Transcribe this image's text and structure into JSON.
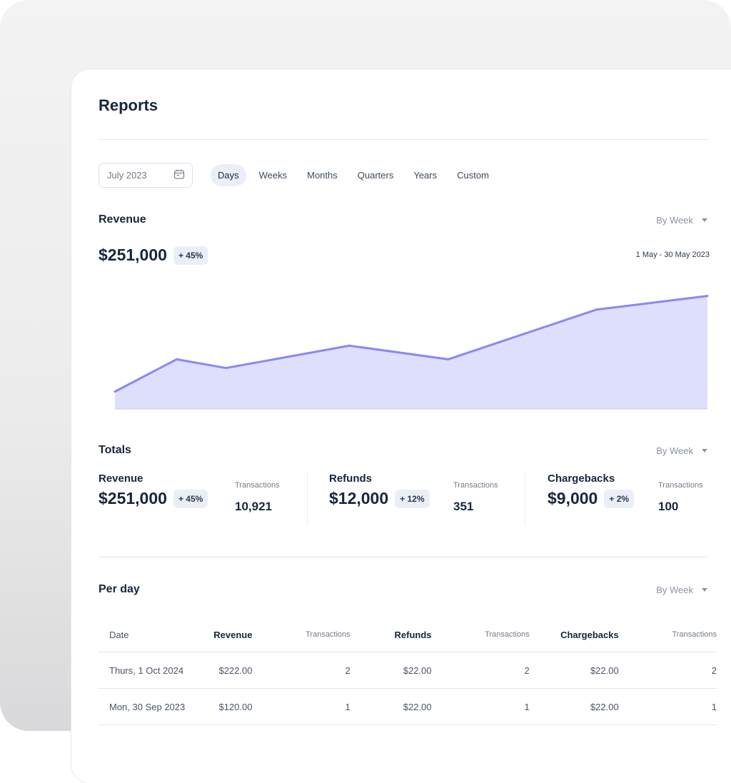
{
  "page": {
    "title": "Reports"
  },
  "filters": {
    "date_value": "July 2023",
    "date_icon": "calendar-icon",
    "tabs": [
      {
        "label": "Days",
        "active": true
      },
      {
        "label": "Weeks",
        "active": false
      },
      {
        "label": "Months",
        "active": false
      },
      {
        "label": "Quarters",
        "active": false
      },
      {
        "label": "Years",
        "active": false
      },
      {
        "label": "Custom",
        "active": false
      }
    ]
  },
  "revenue": {
    "title": "Revenue",
    "group_by": "By Week",
    "total": "$251,000",
    "change": "+ 45%",
    "range": "1 May - 30 May 2023"
  },
  "chart_data": {
    "type": "area",
    "title": "Revenue",
    "xlabel": "",
    "ylabel": "",
    "x_range": "1 May - 30 May 2023",
    "grid": false,
    "legend": "none",
    "x": [
      1,
      6,
      10,
      20,
      28,
      40,
      49
    ],
    "series": [
      {
        "name": "Revenue",
        "values": [
          14,
          40,
          33,
          51,
          40,
          80,
          91
        ]
      }
    ],
    "ylim": [
      0,
      100
    ],
    "colors": {
      "line": "#8b87f5",
      "fill": "#dedefd"
    }
  },
  "totals": {
    "title": "Totals",
    "group_by": "By Week",
    "items": [
      {
        "label": "Revenue",
        "value": "$251,000",
        "change": "+ 45%",
        "transactions_label": "Transactions",
        "transactions": "10,921"
      },
      {
        "label": "Refunds",
        "value": "$12,000",
        "change": "+ 12%",
        "transactions_label": "Transactions",
        "transactions": "351"
      },
      {
        "label": "Chargebacks",
        "value": "$9,000",
        "change": "+ 2%",
        "transactions_label": "Transactions",
        "transactions": "100"
      }
    ]
  },
  "per_day": {
    "title": "Per day",
    "group_by": "By Week",
    "columns": [
      "Date",
      "Revenue",
      "Transactions",
      "Refunds",
      "Transactions",
      "Chargebacks",
      "Transactions"
    ],
    "rows": [
      [
        "Thurs, 1 Oct 2024",
        "$222.00",
        "2",
        "$22.00",
        "2",
        "$22.00",
        "2"
      ],
      [
        "Mon, 30 Sep 2023",
        "$120.00",
        "1",
        "$22.00",
        "1",
        "$22.00",
        "1"
      ]
    ]
  }
}
